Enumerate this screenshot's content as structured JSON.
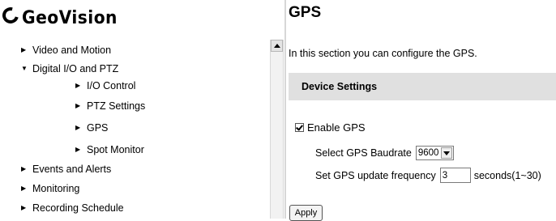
{
  "logo": {
    "text": "GeoVision"
  },
  "sidebar": {
    "items": [
      {
        "label": "Video and Motion",
        "arrow": "right"
      },
      {
        "label": "Digital I/O and PTZ",
        "arrow": "down"
      },
      {
        "label": "I/O Control",
        "arrow": "right"
      },
      {
        "label": "PTZ Settings",
        "arrow": "right"
      },
      {
        "label": "GPS",
        "arrow": "right"
      },
      {
        "label": "Spot Monitor",
        "arrow": "right"
      },
      {
        "label": "Events and Alerts",
        "arrow": "right"
      },
      {
        "label": "Monitoring",
        "arrow": "right"
      },
      {
        "label": "Recording Schedule",
        "arrow": "right"
      }
    ]
  },
  "main": {
    "title": "GPS",
    "intro": "In this section you can configure the GPS.",
    "section": {
      "title": "Device Settings"
    },
    "enable_gps": {
      "label": "Enable GPS",
      "checked": true
    },
    "baudrate": {
      "label": "Select GPS Baudrate",
      "value": "9600"
    },
    "frequency": {
      "label": "Set GPS update frequency",
      "value": "3",
      "unit": "seconds(1~30)"
    },
    "apply_label": "Apply"
  }
}
